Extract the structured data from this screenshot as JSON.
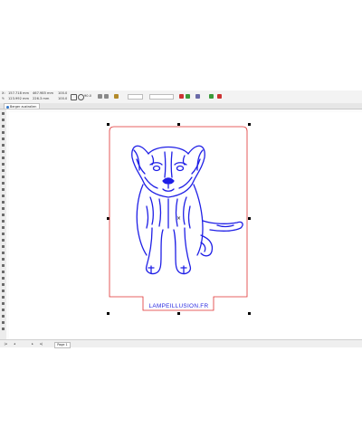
{
  "window": {
    "doc_tab": "Berger australien 3D..."
  },
  "property_bar": {
    "x_label": "X:",
    "x_value": "157.718 mm",
    "y_label": "Y:",
    "y_value": "123.992 mm",
    "w_value": "467.985 mm",
    "h_value": "226.3 mm",
    "scale_x": "100.0",
    "scale_y": "100.0",
    "rotate": "90.0",
    "outline": "Hairline"
  },
  "statusbar": {
    "page_tab": "Page 1",
    "nav_first": "|◂",
    "nav_prev": "◂",
    "nav_next": "▸",
    "nav_last": "▸|"
  },
  "artwork": {
    "brand_text": "LAMPEILLUSION.FR",
    "stroke_color": "#1f1fe6",
    "cutline_color": "#e03030"
  },
  "icons": [
    "select-tool-icon",
    "shape-tool-icon",
    "crop-icon",
    "zoom-icon",
    "freehand-icon",
    "rectangle-icon",
    "ellipse-icon",
    "polygon-icon",
    "text-icon",
    "fill-icon",
    "eyedropper-icon",
    "interactive-fill-icon"
  ]
}
